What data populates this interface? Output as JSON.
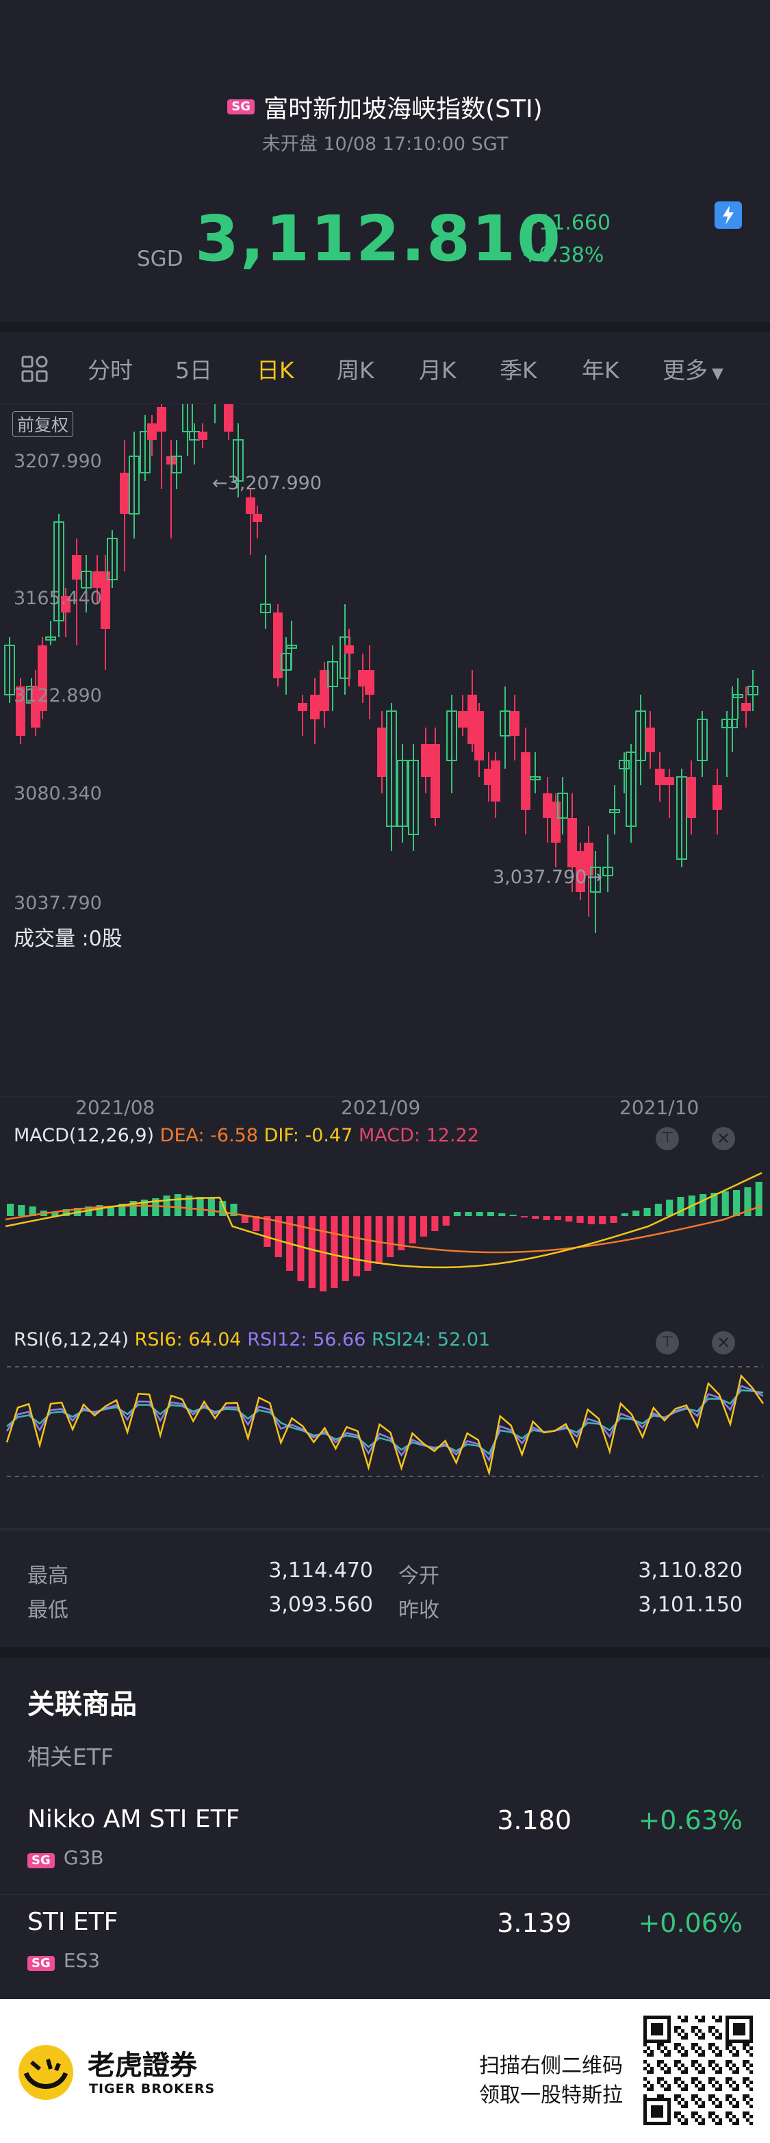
{
  "header": {
    "market_badge": "SG",
    "title": "富时新加坡海峡指数(STI)",
    "status": "未开盘 10/08 17:10:00 SGT",
    "currency": "SGD",
    "price": "3,112.810",
    "change": "+11.660",
    "change_pct": "+0.38%",
    "flash_icon": "lightning-icon"
  },
  "tabs": {
    "grid_icon": "grid-icon",
    "items": [
      "分时",
      "5日",
      "日K",
      "周K",
      "月K",
      "季K",
      "年K",
      "更多"
    ],
    "active": "日K",
    "more_icon": "caret-down-icon"
  },
  "kline": {
    "adjust_label": "前复权",
    "y_labels": [
      "3207.990",
      "3165.440",
      "3122.890",
      "3080.340",
      "3037.790"
    ],
    "high_marker": "3,207.990",
    "low_marker": "3,037.790",
    "volume_label": "成交量 :0股",
    "x_labels": [
      "2021/08",
      "2021/09",
      "2021/10"
    ],
    "colors": {
      "up": "#34c77b",
      "down": "#f5355d"
    }
  },
  "macd": {
    "label": "MACD(12,26,9)",
    "dea": "DEA: -6.58",
    "dif": "DIF: -0.47",
    "macd": "MACD: 12.22",
    "colors": {
      "dea": "#f07a2a",
      "dif": "#f5c518",
      "macd": "#e2446c"
    }
  },
  "rsi": {
    "label": "RSI(6,12,24)",
    "rsi6": "RSI6: 64.04",
    "rsi12": "RSI12: 56.66",
    "rsi24": "RSI24: 52.01",
    "colors": {
      "rsi6": "#f5c518",
      "rsi12": "#8f7cf5",
      "rsi24": "#3fb8a8"
    }
  },
  "stats": {
    "high_label": "最高",
    "high": "3,114.470",
    "open_label": "今开",
    "open": "3,110.820",
    "low_label": "最低",
    "low": "3,093.560",
    "prev_label": "昨收",
    "prev": "3,101.150"
  },
  "related": {
    "title": "关联商品",
    "subtitle": "相关ETF",
    "items": [
      {
        "name": "Nikko AM STI ETF",
        "badge": "SG",
        "code": "G3B",
        "price": "3.180",
        "change": "+0.63%"
      },
      {
        "name": "STI ETF",
        "badge": "SG",
        "code": "ES3",
        "price": "3.139",
        "change": "+0.06%"
      }
    ]
  },
  "footer": {
    "brand_cn": "老虎證券",
    "brand_en": "TIGER BROKERS",
    "line1": "扫描右侧二维码",
    "line2": "领取一股特斯拉"
  }
}
